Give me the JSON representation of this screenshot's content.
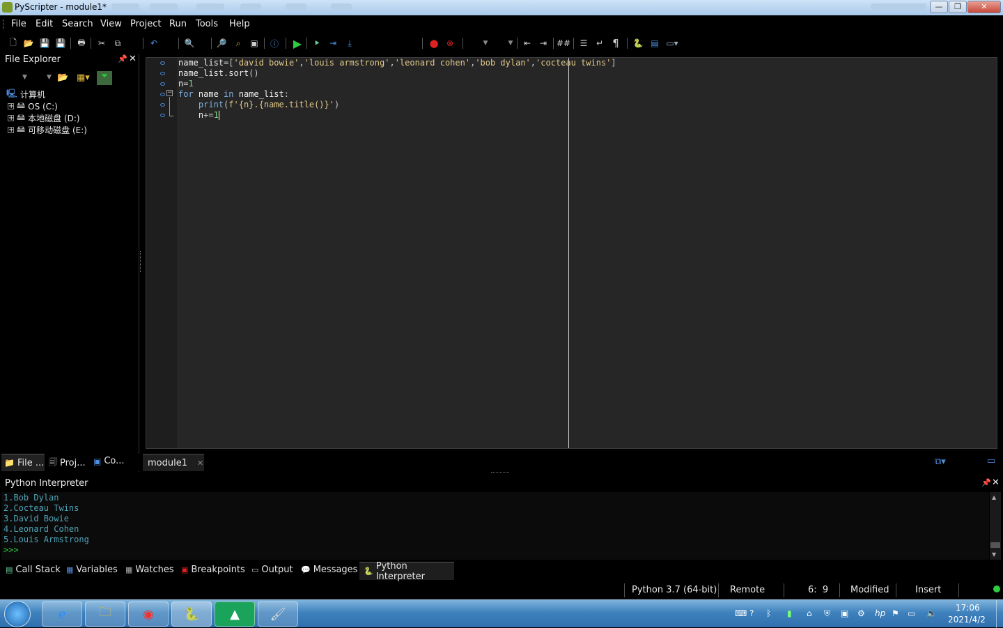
{
  "window": {
    "title": "PyScripter - module1*",
    "min": "—",
    "max": "❐",
    "close": "✕"
  },
  "menu": [
    "File",
    "Edit",
    "Search",
    "View",
    "Project",
    "Run",
    "Tools",
    "Help"
  ],
  "toolbar": [
    "new-file-icon",
    "open-file-icon",
    "save-icon",
    "save-all-icon",
    "print-icon",
    "cut-icon",
    "copy-icon",
    "undo-icon",
    "find-icon",
    "find-in-files-icon",
    "replace-icon",
    "find-next-icon",
    "info-icon",
    "run-icon",
    "debug-icon",
    "step-into-icon",
    "step-over-icon",
    "breakpoint-icon",
    "clear-breakpoints-icon",
    "indent-icon",
    "dedent-icon",
    "comment-icon",
    "list-icon",
    "word-wrap-icon",
    "pilcrow-icon",
    "python-icon",
    "layout-icon",
    "window-icon"
  ],
  "file_explorer": {
    "title": "File Explorer",
    "tree": [
      {
        "label": "计算机",
        "icon": "computer-icon"
      },
      {
        "label": "OS (C:)",
        "icon": "drive-icon"
      },
      {
        "label": "本地磁盘 (D:)",
        "icon": "drive-icon"
      },
      {
        "label": "可移动磁盘 (E:)",
        "icon": "drive-icon"
      }
    ],
    "tabs": [
      "File ...",
      "Proj...",
      "Co..."
    ]
  },
  "editor": {
    "tab": "module1",
    "lines": [
      [
        [
          "id",
          "name_list"
        ],
        [
          "op",
          "=["
        ],
        [
          "str",
          "'david bowie'"
        ],
        [
          "op",
          ","
        ],
        [
          "str",
          "'louis armstrong'"
        ],
        [
          "op",
          ","
        ],
        [
          "str",
          "'leonard cohen'"
        ],
        [
          "op",
          ","
        ],
        [
          "str",
          "'bob dylan'"
        ],
        [
          "op",
          ","
        ],
        [
          "str",
          "'cocteau twins'"
        ],
        [
          "op",
          "]"
        ]
      ],
      [
        [
          "id",
          "name_list"
        ],
        [
          "op",
          "."
        ],
        [
          "id",
          "sort"
        ],
        [
          "op",
          "()"
        ]
      ],
      [
        [
          "id",
          "n"
        ],
        [
          "op",
          "="
        ],
        [
          "num",
          "1"
        ]
      ],
      [
        [
          "kw",
          "for"
        ],
        [
          "id",
          " name "
        ],
        [
          "kw",
          "in"
        ],
        [
          "id",
          " name_list"
        ],
        [
          "op",
          ":"
        ]
      ],
      [
        [
          "id",
          "    "
        ],
        [
          "kw",
          "print"
        ],
        [
          "op",
          "("
        ],
        [
          "str",
          "f'{n}.{name.title()}'"
        ],
        [
          "op",
          ")"
        ]
      ],
      [
        [
          "id",
          "    n"
        ],
        [
          "op",
          "+="
        ],
        [
          "num",
          "1"
        ]
      ]
    ]
  },
  "interpreter": {
    "title": "Python Interpreter",
    "output": [
      "1.Bob Dylan",
      "2.Cocteau Twins",
      "3.David Bowie",
      "4.Leonard Cohen",
      "5.Louis Armstrong"
    ],
    "prompt": ">>>"
  },
  "bottom_tabs": [
    "Call Stack",
    "Variables",
    "Watches",
    "Breakpoints",
    "Output",
    "Messages",
    "Python Interpreter"
  ],
  "status": {
    "python": "Python 3.7 (64-bit)",
    "engine": "Remote",
    "position": "6:  9",
    "modified": "Modified",
    "mode": "Insert"
  },
  "clock": {
    "time": "17:06",
    "date": "2021/4/2"
  },
  "colors": {
    "string": "#e3c98b",
    "keyword": "#7fb0e0",
    "number": "#7fd47f",
    "output": "#4fa3b8"
  }
}
